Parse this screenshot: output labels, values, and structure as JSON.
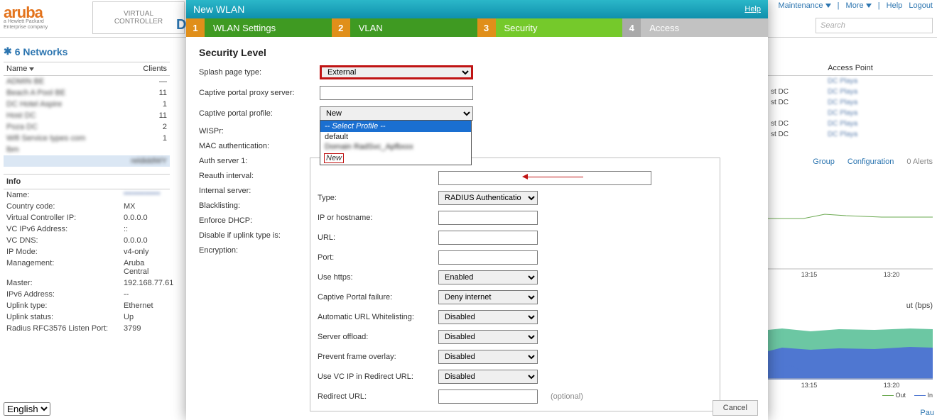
{
  "topmenu": {
    "maintenance": "Maintenance",
    "more": "More",
    "help": "Help",
    "logout": "Logout"
  },
  "brand": {
    "name": "aruba",
    "sub1": "a Hewlett Packard",
    "sub2": "Enterprise company",
    "vc": "VIRTUAL\nCONTROLLER",
    "d": "D"
  },
  "search": {
    "placeholder": "Search"
  },
  "networks": {
    "title": "6 Networks",
    "cols": {
      "name": "Name",
      "clients": "Clients"
    },
    "rows": [
      {
        "name": "ADMIN BE",
        "clients": "—"
      },
      {
        "name": "Beach A Pool BE",
        "clients": "11"
      },
      {
        "name": "DC Hotel Aspire",
        "clients": "1"
      },
      {
        "name": "Host DC",
        "clients": "11"
      },
      {
        "name": "Poza DC",
        "clients": "2"
      },
      {
        "name": "Wifi Service types com",
        "clients": "1"
      },
      {
        "name": "lbm",
        "clients": ""
      }
    ],
    "selrow": "reldiddWY"
  },
  "info": {
    "title": "Info",
    "rows": [
      {
        "lbl": "Name:",
        "val": "************"
      },
      {
        "lbl": "Country code:",
        "val": "MX"
      },
      {
        "lbl": "Virtual Controller IP:",
        "val": "0.0.0.0"
      },
      {
        "lbl": "VC IPv6 Address:",
        "val": "::"
      },
      {
        "lbl": "VC DNS:",
        "val": "0.0.0.0"
      },
      {
        "lbl": "IP Mode:",
        "val": "v4-only"
      },
      {
        "lbl": "Management:",
        "val": "Aruba Central"
      },
      {
        "lbl": "Master:",
        "val": "192.168.77.61"
      },
      {
        "lbl": "IPv6 Address:",
        "val": "--"
      },
      {
        "lbl": "Uplink type:",
        "val": "Ethernet"
      },
      {
        "lbl": "Uplink status:",
        "val": "Up"
      },
      {
        "lbl": "Radius RFC3576 Listen Port:",
        "val": "3799"
      }
    ]
  },
  "lang": "English",
  "ap": {
    "title": "Access Point",
    "rows": [
      {
        "c1": "",
        "c2": "DC Playa"
      },
      {
        "c1": "st DC",
        "c2": "DC Playa"
      },
      {
        "c1": "st DC",
        "c2": "DC Playa"
      },
      {
        "c1": "",
        "c2": "DC Playa"
      },
      {
        "c1": "st DC",
        "c2": "DC Playa"
      },
      {
        "c1": "st DC",
        "c2": "DC Playa"
      }
    ]
  },
  "links": {
    "group": "Group",
    "config": "Configuration",
    "alerts": "0 Alerts"
  },
  "charts": {
    "t1": "13:15",
    "t2": "13:20",
    "title2": "ut  (bps)",
    "leg1": "Out",
    "leg2": "In"
  },
  "chart_data": [
    {
      "type": "line",
      "series": [
        {
          "name": "Out",
          "color": "#6aa84f",
          "values": [
            9,
            9,
            9,
            10,
            10,
            9.8,
            9.8,
            9.8,
            9.8,
            9.8
          ]
        }
      ],
      "xlabels": [
        "13:15",
        "13:20"
      ],
      "ylim": [
        0,
        12
      ]
    },
    {
      "type": "area",
      "series": [
        {
          "name": "Out",
          "color": "#6cc7a3",
          "values": [
            65,
            66,
            64,
            66,
            65,
            67,
            66,
            65,
            64,
            66
          ]
        },
        {
          "name": "In",
          "color": "#4f77d1",
          "values": [
            45,
            46,
            44,
            46,
            45,
            47,
            46,
            45,
            44,
            46
          ]
        }
      ],
      "xlabels": [
        "13:15",
        "13:20"
      ],
      "ylim": [
        0,
        100
      ]
    }
  ],
  "pau": "Pau",
  "dialog": {
    "title": "New WLAN",
    "help": "Help",
    "steps": {
      "n1": "1",
      "l1": "WLAN Settings",
      "n2": "2",
      "l2": "VLAN",
      "n3": "3",
      "l3": "Security",
      "n4": "4",
      "l4": "Access"
    },
    "sectitle": "Security Level",
    "labels": {
      "splash": "Splash page type:",
      "proxy": "Captive portal proxy server:",
      "profile": "Captive portal profile:",
      "wispr": "WISPr:",
      "mac": "MAC authentication:",
      "auth": "Auth server 1:",
      "reauth": "Reauth interval:",
      "internal": "Internal server:",
      "black": "Blacklisting:",
      "dhcp": "Enforce DHCP:",
      "disable": "Disable if uplink type is:",
      "enc": "Encryption:"
    },
    "values": {
      "splash": "External",
      "profile": "New"
    },
    "dd": {
      "head": "-- Select Profile --",
      "opt1": "default",
      "opt2": "Domain RadSvc_Apfbxxx",
      "opt3": "New"
    },
    "inner": {
      "type_l": "Type:",
      "type_v": "RADIUS Authenticatio",
      "ip_l": "IP or hostname:",
      "url_l": "URL:",
      "port_l": "Port:",
      "https_l": "Use https:",
      "https_v": "Enabled",
      "fail_l": "Captive Portal failure:",
      "fail_v": "Deny internet",
      "awl_l": "Automatic URL Whitelisting:",
      "awl_v": "Disabled",
      "off_l": "Server offload:",
      "off_v": "Disabled",
      "frame_l": "Prevent frame overlay:",
      "frame_v": "Disabled",
      "vcip_l": "Use VC IP in Redirect URL:",
      "vcip_v": "Disabled",
      "rurl_l": "Redirect URL:",
      "optional": "(optional)"
    },
    "cancel": "Cancel"
  }
}
